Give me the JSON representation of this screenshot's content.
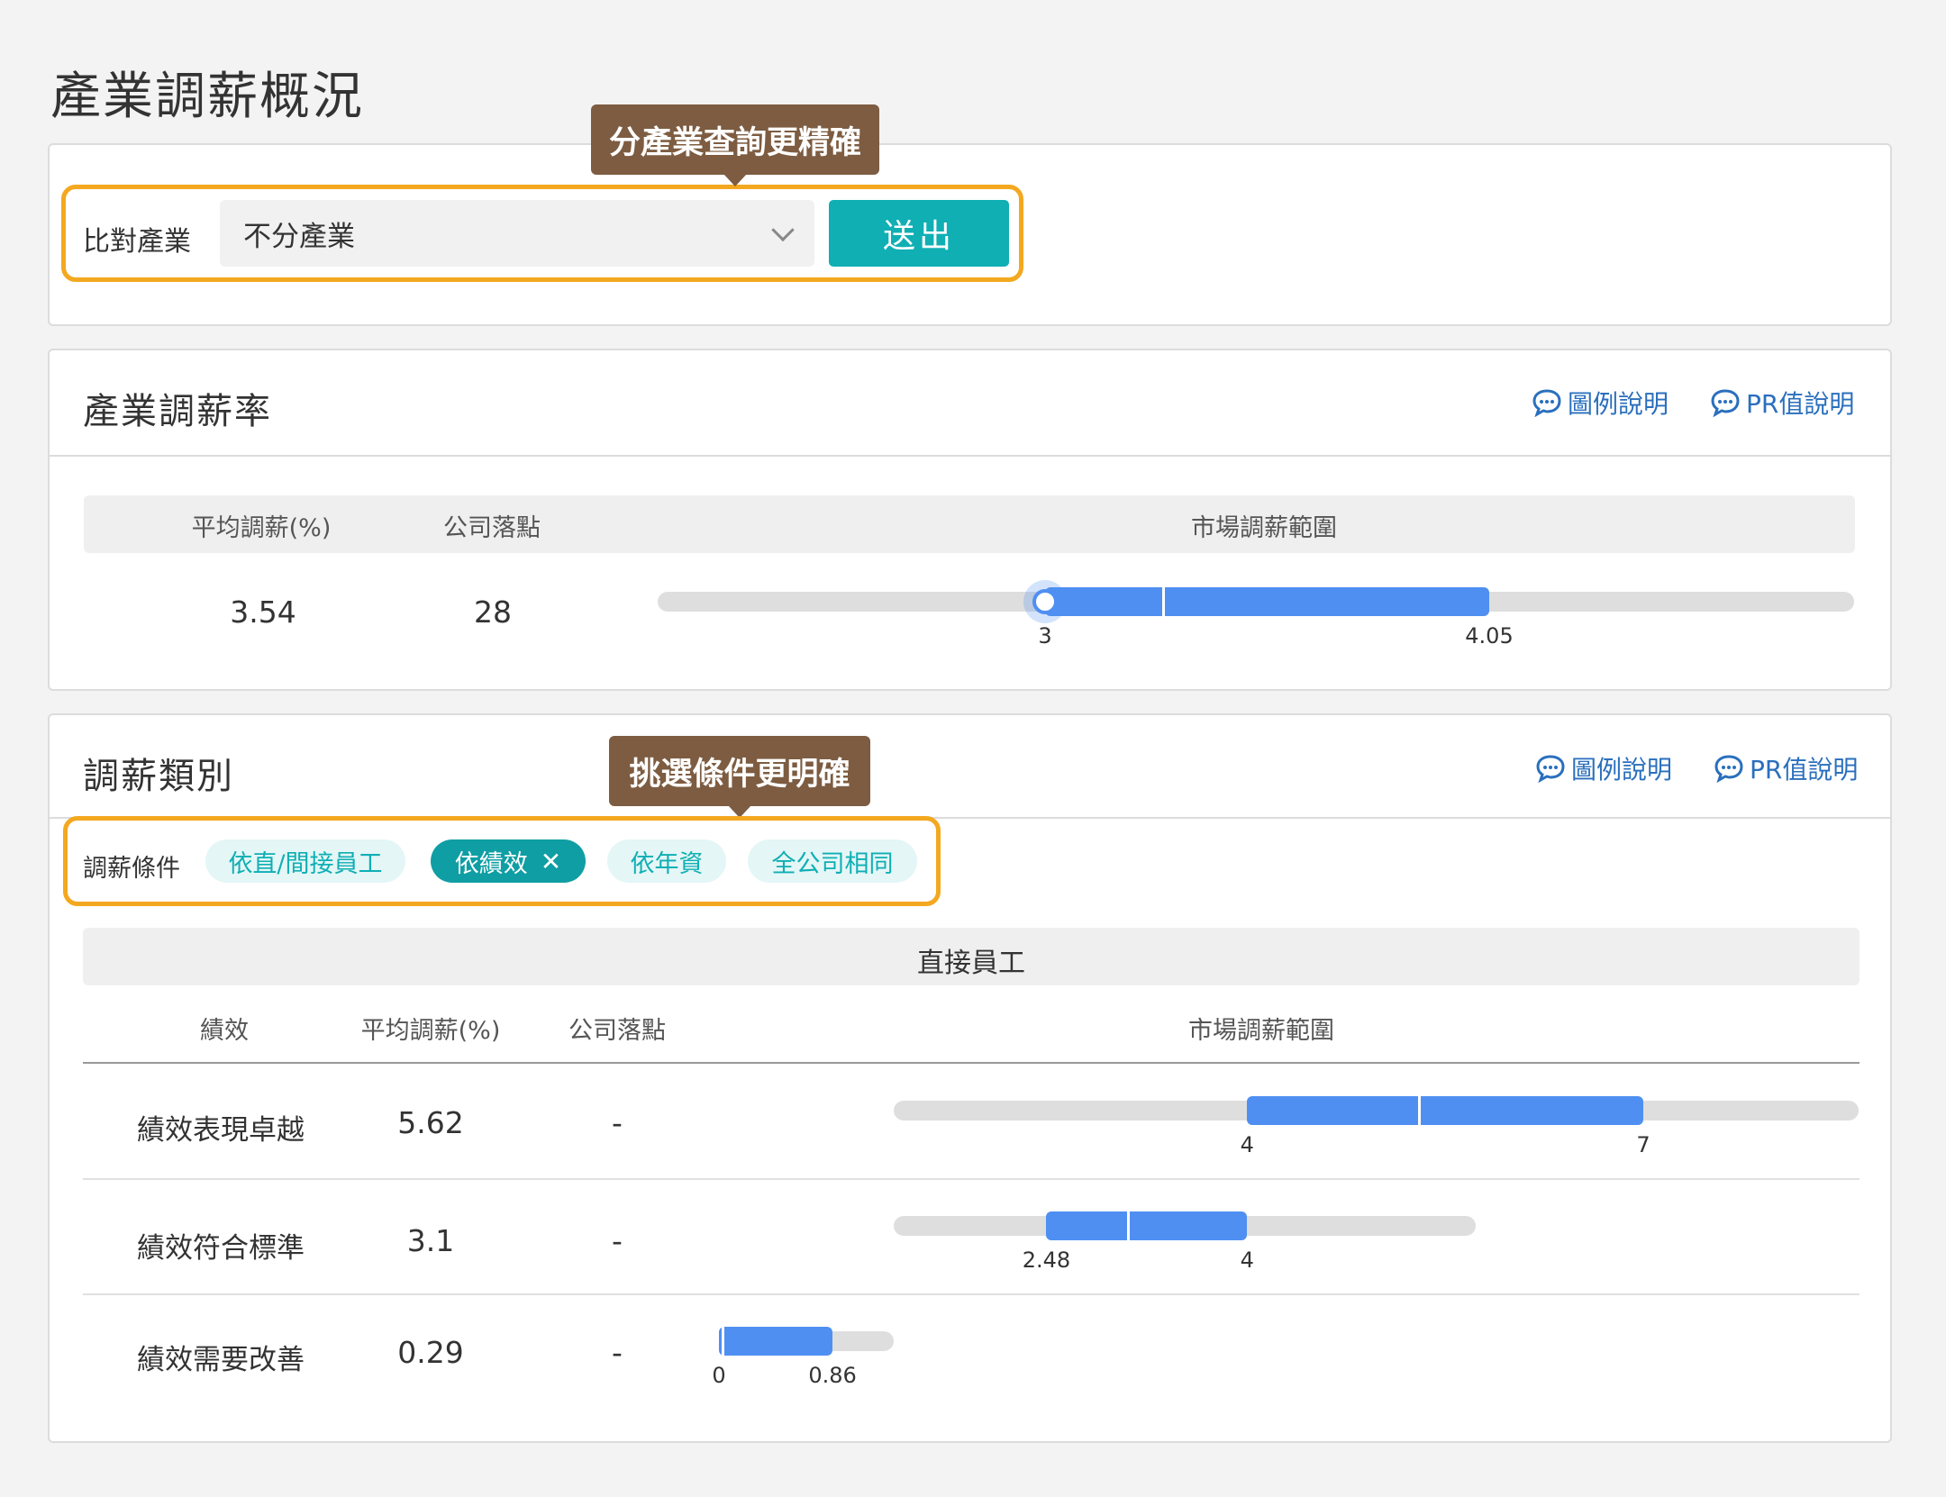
{
  "page_title": "產業調薪概況",
  "tooltips": {
    "industry": "分產業查詢更精確",
    "conditions": "挑選條件更明確"
  },
  "compare": {
    "label": "比對產業",
    "select_value": "不分產業",
    "submit_label": "送出"
  },
  "links": {
    "legend": "圖例說明",
    "pr": "PR值說明"
  },
  "industry_rate": {
    "title": "產業調薪率",
    "headers": [
      "平均調薪(%)",
      "公司落點",
      "市場調薪範圍"
    ],
    "avg": "3.54",
    "company_point": "28",
    "range": {
      "low": 3,
      "median": 3.28,
      "high": 4.05,
      "low_label": "3",
      "high_label": "4.05",
      "company_marker": 3
    }
  },
  "category": {
    "title": "調薪類別",
    "conditions_label": "調薪條件",
    "chips": [
      {
        "label": "依直/間接員工",
        "selected": false
      },
      {
        "label": "依績效",
        "selected": true
      },
      {
        "label": "依年資",
        "selected": false
      },
      {
        "label": "全公司相同",
        "selected": false
      }
    ],
    "group_title": "直接員工",
    "headers": [
      "績效",
      "平均調薪(%)",
      "公司落點",
      "市場調薪範圍"
    ],
    "rows": [
      {
        "label": "績效表現卓越",
        "avg": "5.62",
        "company": "-",
        "low": 4,
        "median": 5.3,
        "high": 7,
        "low_label": "4",
        "high_label": "7"
      },
      {
        "label": "績效符合標準",
        "avg": "3.1",
        "company": "-",
        "low": 2.48,
        "median": 3.1,
        "high": 4,
        "low_label": "2.48",
        "high_label": "4"
      },
      {
        "label": "績效需要改善",
        "avg": "0.29",
        "company": "-",
        "low": 0,
        "median": 0.03,
        "high": 0.86,
        "low_label": "0",
        "high_label": "0.86"
      }
    ]
  },
  "colors": {
    "accent_teal": "#0fafb4",
    "bar_blue": "#4f8ff2",
    "highlight_orange": "#f3a81f",
    "tooltip_brown": "#7d5c41",
    "link_blue": "#2a6fbd"
  }
}
